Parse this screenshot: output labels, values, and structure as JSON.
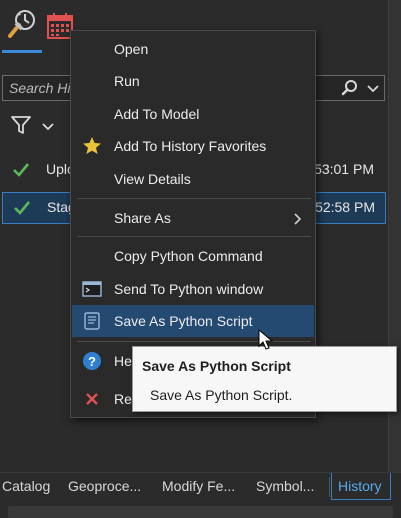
{
  "search": {
    "placeholder": "Search Hi"
  },
  "history_items": [
    {
      "name": "Uplo",
      "time": "53:01 PM",
      "selected": false
    },
    {
      "name": "Stag",
      "time": "52:58 PM",
      "selected": true
    }
  ],
  "context_menu": {
    "items": [
      {
        "label": "Open",
        "icon": ""
      },
      {
        "label": "Run",
        "icon": ""
      },
      {
        "label": "Add To Model",
        "icon": ""
      },
      {
        "label": "Add To History Favorites",
        "icon": "star-icon"
      },
      {
        "label": "View Details",
        "icon": ""
      },
      {
        "label": "Share As",
        "icon": "",
        "submenu": true
      },
      {
        "label": "Copy Python Command",
        "icon": ""
      },
      {
        "label": "Send To Python window",
        "icon": "python-window-icon"
      },
      {
        "label": "Save As Python Script",
        "icon": "python-script-icon",
        "highlighted": true
      },
      {
        "label": "He",
        "icon": "help-icon"
      },
      {
        "label": "Re",
        "icon": "remove-x-icon"
      }
    ]
  },
  "tooltip": {
    "title": "Save As Python Script",
    "description": "Save As Python Script."
  },
  "bottom_tabs": [
    {
      "label": "Catalog"
    },
    {
      "label": "Geoproce..."
    },
    {
      "label": "Modify Fe..."
    },
    {
      "label": "Symbol..."
    },
    {
      "label": "History",
      "active": true
    }
  ],
  "colors": {
    "accent": "#3b8ad9",
    "menu_highlight": "#254a72",
    "check_green": "#5cb85c",
    "star_gold": "#e8c33a",
    "remove_red": "#e05252"
  }
}
